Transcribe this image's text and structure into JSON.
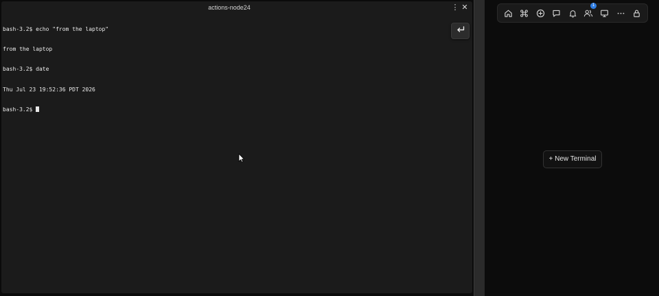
{
  "terminal": {
    "title": "actions-node24",
    "menu_glyph": "⋮",
    "close_glyph": "✕",
    "lines": [
      "bash-3.2$ echo \"from the laptop\"",
      "from the laptop",
      "bash-3.2$ date",
      "Thu Jul 23 19:52:36 PDT 2026",
      "bash-3.2$ "
    ],
    "enter_icon": "enter-return-icon"
  },
  "toolbar": {
    "icons": [
      "home-icon",
      "command-icon",
      "plus-circle-icon",
      "chat-icon",
      "bell-icon",
      "users-icon",
      "monitor-icon",
      "more-horizontal-icon",
      "lock-icon"
    ],
    "users_badge": "1",
    "badge_color": "#2f7de1"
  },
  "sidebar": {
    "new_terminal_label": "+ New Terminal"
  }
}
